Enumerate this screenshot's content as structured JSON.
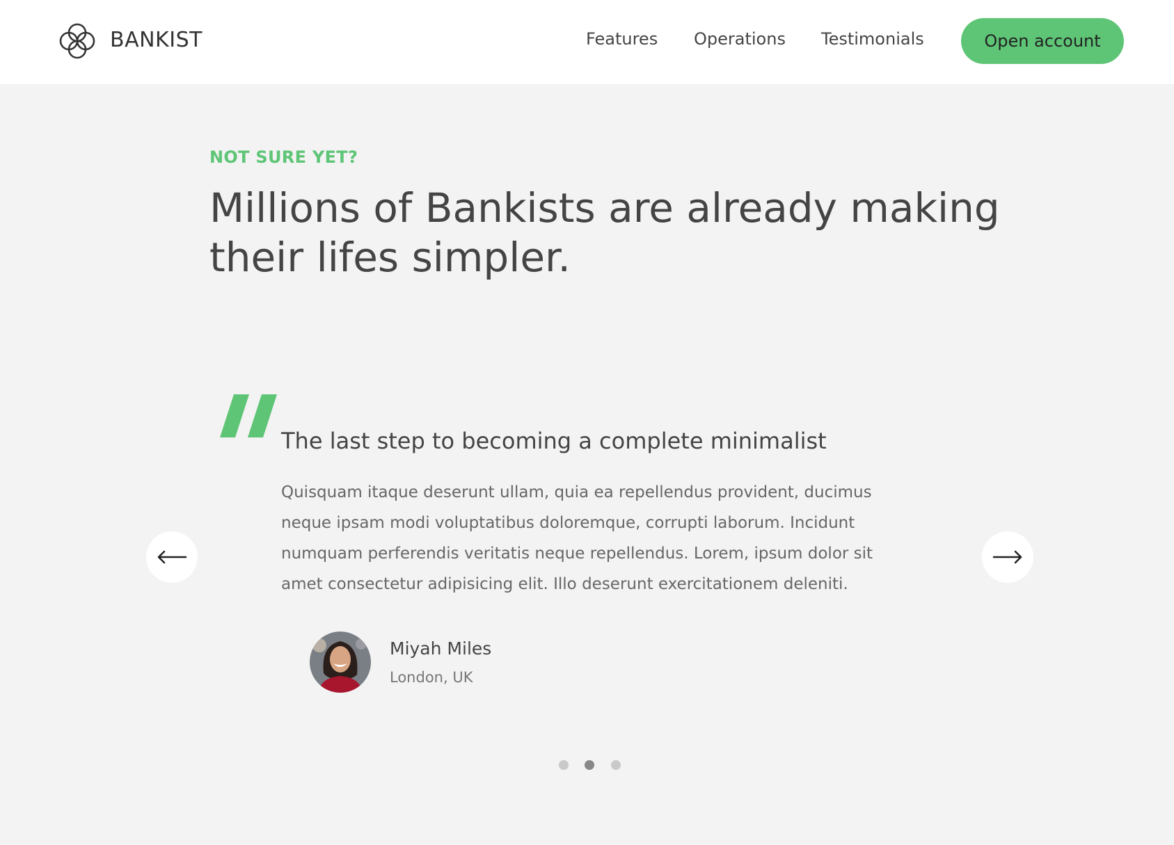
{
  "header": {
    "brand": "BANKIST",
    "nav": [
      "Features",
      "Operations",
      "Testimonials"
    ],
    "cta_label": "Open account"
  },
  "section": {
    "eyebrow": "NOT SURE YET?",
    "headline": "Millions of Bankists are already making their lifes simpler."
  },
  "testimonial": {
    "title": "The last step to becoming a complete minimalist",
    "body": "Quisquam itaque deserunt ullam, quia ea repellendus provident, ducimus neque ipsam modi voluptatibus doloremque, corrupti laborum. Incidunt numquam perferendis veritatis neque repellendus. Lorem, ipsum dolor sit amet consectetur adipisicing elit. Illo deserunt exercitationem deleniti.",
    "author_name": "Miyah Miles",
    "author_location": "London, UK"
  },
  "slider": {
    "slide_count": 3,
    "active_index": 1
  },
  "colors": {
    "accent": "#5ec576",
    "background": "#f3f3f3",
    "text": "#444444"
  },
  "icons": {
    "logo": "bankist-logo-icon",
    "quote": "quote-icon",
    "prev": "arrow-left-icon",
    "next": "arrow-right-icon"
  }
}
